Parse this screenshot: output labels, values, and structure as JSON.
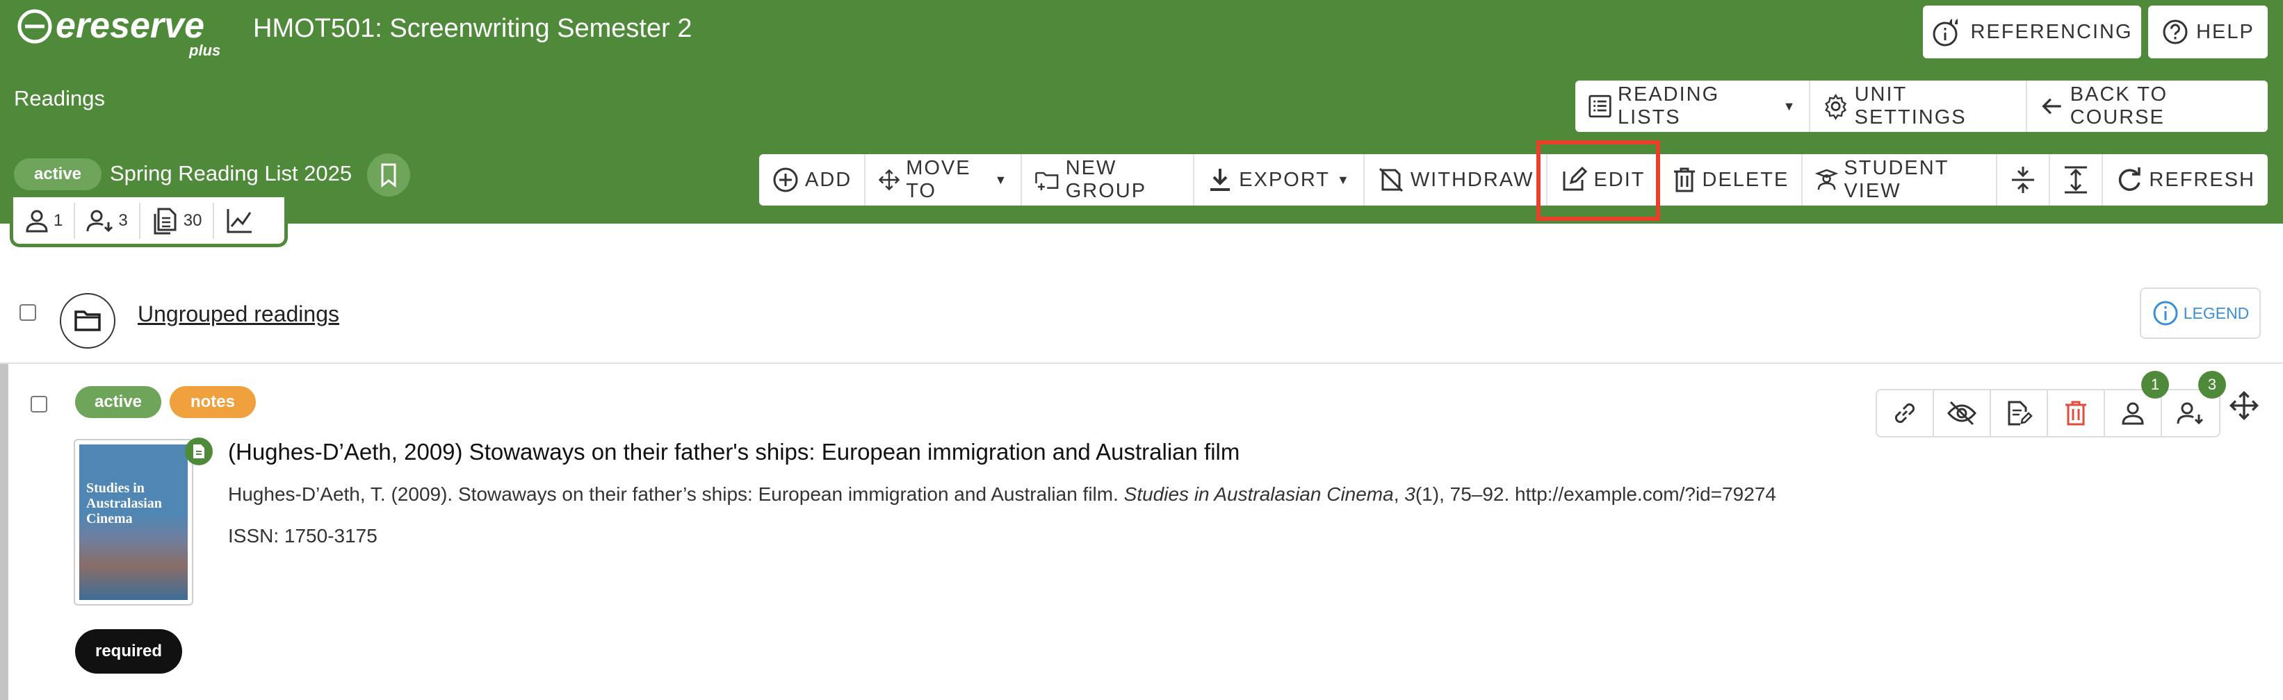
{
  "app": {
    "logo_text": "ereserve",
    "logo_sub": "plus",
    "course_title": "HMOT501: Screenwriting Semester 2",
    "section_label": "Readings"
  },
  "header_buttons": {
    "referencing": "REFERENCING",
    "help": "HELP"
  },
  "nav_buttons": {
    "reading_lists": "READING LISTS",
    "unit_settings": "UNIT SETTINGS",
    "back_to_course": "BACK TO COURSE"
  },
  "reading_list": {
    "status": "active",
    "name": "Spring Reading List 2025"
  },
  "stats": {
    "users": "1",
    "students": "3",
    "readings": "30"
  },
  "toolbar": {
    "add": "ADD",
    "move_to": "MOVE TO",
    "new_group": "NEW GROUP",
    "export": "EXPORT",
    "withdraw": "WITHDRAW",
    "edit": "EDIT",
    "delete": "DELETE",
    "student_view": "STUDENT VIEW",
    "refresh": "REFRESH"
  },
  "group": {
    "label": " Ungrouped readings",
    "legend": "LEGEND"
  },
  "item": {
    "status": "active",
    "notes": "notes",
    "title": "(Hughes-D’Aeth, 2009) Stowaways on their father's ships: European immigration and Australian film",
    "citation_prefix": "Hughes-D’Aeth, T. (2009). Stowaways on their father’s ships: European immigration and Australian film. ",
    "citation_journal": "Studies in Australasian Cinema",
    "citation_sep": ", ",
    "citation_volume": "3",
    "citation_suffix": "(1), 75–92. http://example.com/?id=79274",
    "issn": "ISSN: 1750-3175",
    "requirement": "required",
    "thumb_title": "Studies in Australasian Cinema",
    "badge_users": "1",
    "badge_students": "3"
  },
  "colors": {
    "header_green": "#4e8a3a",
    "active_pill": "#6ea55a",
    "notes_pill": "#f0a03c",
    "highlight_red": "#e8412a",
    "legend_blue": "#3a8fd8",
    "delete_red": "#e24b3b"
  }
}
